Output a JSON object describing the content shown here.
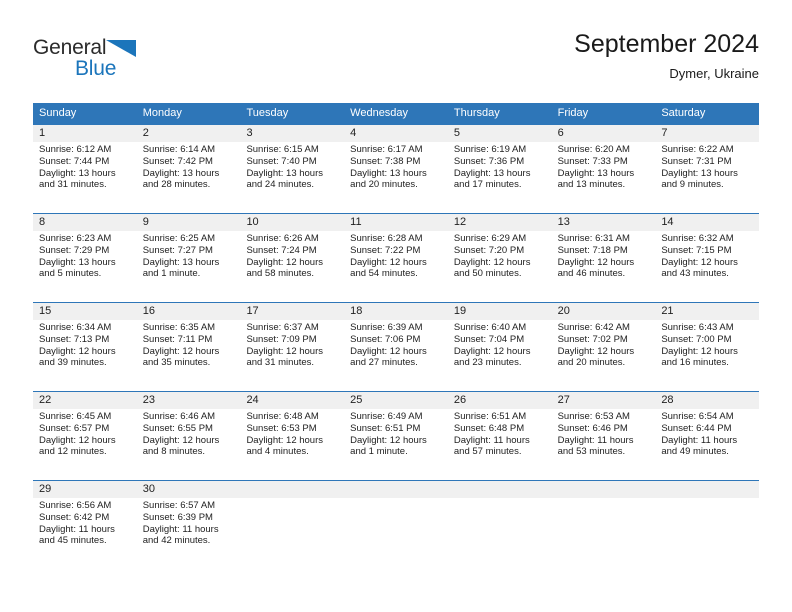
{
  "brand": {
    "name_part1": "General",
    "name_part2": "Blue",
    "triangle_color": "#1b75bb",
    "text_color_part1": "#2b2b2b"
  },
  "header": {
    "title": "September 2024",
    "subtitle": "Dymer, Ukraine"
  },
  "colors": {
    "header_bar": "#2e76b8",
    "day_number_row": "#f0f0f0",
    "text": "#222222",
    "accent_blue": "#1b75bb"
  },
  "weekdays": [
    "Sunday",
    "Monday",
    "Tuesday",
    "Wednesday",
    "Thursday",
    "Friday",
    "Saturday"
  ],
  "weeks": [
    {
      "days": [
        {
          "num": "1",
          "sunrise": "Sunrise: 6:12 AM",
          "sunset": "Sunset: 7:44 PM",
          "daylight1": "Daylight: 13 hours",
          "daylight2": "and 31 minutes."
        },
        {
          "num": "2",
          "sunrise": "Sunrise: 6:14 AM",
          "sunset": "Sunset: 7:42 PM",
          "daylight1": "Daylight: 13 hours",
          "daylight2": "and 28 minutes."
        },
        {
          "num": "3",
          "sunrise": "Sunrise: 6:15 AM",
          "sunset": "Sunset: 7:40 PM",
          "daylight1": "Daylight: 13 hours",
          "daylight2": "and 24 minutes."
        },
        {
          "num": "4",
          "sunrise": "Sunrise: 6:17 AM",
          "sunset": "Sunset: 7:38 PM",
          "daylight1": "Daylight: 13 hours",
          "daylight2": "and 20 minutes."
        },
        {
          "num": "5",
          "sunrise": "Sunrise: 6:19 AM",
          "sunset": "Sunset: 7:36 PM",
          "daylight1": "Daylight: 13 hours",
          "daylight2": "and 17 minutes."
        },
        {
          "num": "6",
          "sunrise": "Sunrise: 6:20 AM",
          "sunset": "Sunset: 7:33 PM",
          "daylight1": "Daylight: 13 hours",
          "daylight2": "and 13 minutes."
        },
        {
          "num": "7",
          "sunrise": "Sunrise: 6:22 AM",
          "sunset": "Sunset: 7:31 PM",
          "daylight1": "Daylight: 13 hours",
          "daylight2": "and 9 minutes."
        }
      ]
    },
    {
      "days": [
        {
          "num": "8",
          "sunrise": "Sunrise: 6:23 AM",
          "sunset": "Sunset: 7:29 PM",
          "daylight1": "Daylight: 13 hours",
          "daylight2": "and 5 minutes."
        },
        {
          "num": "9",
          "sunrise": "Sunrise: 6:25 AM",
          "sunset": "Sunset: 7:27 PM",
          "daylight1": "Daylight: 13 hours",
          "daylight2": "and 1 minute."
        },
        {
          "num": "10",
          "sunrise": "Sunrise: 6:26 AM",
          "sunset": "Sunset: 7:24 PM",
          "daylight1": "Daylight: 12 hours",
          "daylight2": "and 58 minutes."
        },
        {
          "num": "11",
          "sunrise": "Sunrise: 6:28 AM",
          "sunset": "Sunset: 7:22 PM",
          "daylight1": "Daylight: 12 hours",
          "daylight2": "and 54 minutes."
        },
        {
          "num": "12",
          "sunrise": "Sunrise: 6:29 AM",
          "sunset": "Sunset: 7:20 PM",
          "daylight1": "Daylight: 12 hours",
          "daylight2": "and 50 minutes."
        },
        {
          "num": "13",
          "sunrise": "Sunrise: 6:31 AM",
          "sunset": "Sunset: 7:18 PM",
          "daylight1": "Daylight: 12 hours",
          "daylight2": "and 46 minutes."
        },
        {
          "num": "14",
          "sunrise": "Sunrise: 6:32 AM",
          "sunset": "Sunset: 7:15 PM",
          "daylight1": "Daylight: 12 hours",
          "daylight2": "and 43 minutes."
        }
      ]
    },
    {
      "days": [
        {
          "num": "15",
          "sunrise": "Sunrise: 6:34 AM",
          "sunset": "Sunset: 7:13 PM",
          "daylight1": "Daylight: 12 hours",
          "daylight2": "and 39 minutes."
        },
        {
          "num": "16",
          "sunrise": "Sunrise: 6:35 AM",
          "sunset": "Sunset: 7:11 PM",
          "daylight1": "Daylight: 12 hours",
          "daylight2": "and 35 minutes."
        },
        {
          "num": "17",
          "sunrise": "Sunrise: 6:37 AM",
          "sunset": "Sunset: 7:09 PM",
          "daylight1": "Daylight: 12 hours",
          "daylight2": "and 31 minutes."
        },
        {
          "num": "18",
          "sunrise": "Sunrise: 6:39 AM",
          "sunset": "Sunset: 7:06 PM",
          "daylight1": "Daylight: 12 hours",
          "daylight2": "and 27 minutes."
        },
        {
          "num": "19",
          "sunrise": "Sunrise: 6:40 AM",
          "sunset": "Sunset: 7:04 PM",
          "daylight1": "Daylight: 12 hours",
          "daylight2": "and 23 minutes."
        },
        {
          "num": "20",
          "sunrise": "Sunrise: 6:42 AM",
          "sunset": "Sunset: 7:02 PM",
          "daylight1": "Daylight: 12 hours",
          "daylight2": "and 20 minutes."
        },
        {
          "num": "21",
          "sunrise": "Sunrise: 6:43 AM",
          "sunset": "Sunset: 7:00 PM",
          "daylight1": "Daylight: 12 hours",
          "daylight2": "and 16 minutes."
        }
      ]
    },
    {
      "days": [
        {
          "num": "22",
          "sunrise": "Sunrise: 6:45 AM",
          "sunset": "Sunset: 6:57 PM",
          "daylight1": "Daylight: 12 hours",
          "daylight2": "and 12 minutes."
        },
        {
          "num": "23",
          "sunrise": "Sunrise: 6:46 AM",
          "sunset": "Sunset: 6:55 PM",
          "daylight1": "Daylight: 12 hours",
          "daylight2": "and 8 minutes."
        },
        {
          "num": "24",
          "sunrise": "Sunrise: 6:48 AM",
          "sunset": "Sunset: 6:53 PM",
          "daylight1": "Daylight: 12 hours",
          "daylight2": "and 4 minutes."
        },
        {
          "num": "25",
          "sunrise": "Sunrise: 6:49 AM",
          "sunset": "Sunset: 6:51 PM",
          "daylight1": "Daylight: 12 hours",
          "daylight2": "and 1 minute."
        },
        {
          "num": "26",
          "sunrise": "Sunrise: 6:51 AM",
          "sunset": "Sunset: 6:48 PM",
          "daylight1": "Daylight: 11 hours",
          "daylight2": "and 57 minutes."
        },
        {
          "num": "27",
          "sunrise": "Sunrise: 6:53 AM",
          "sunset": "Sunset: 6:46 PM",
          "daylight1": "Daylight: 11 hours",
          "daylight2": "and 53 minutes."
        },
        {
          "num": "28",
          "sunrise": "Sunrise: 6:54 AM",
          "sunset": "Sunset: 6:44 PM",
          "daylight1": "Daylight: 11 hours",
          "daylight2": "and 49 minutes."
        }
      ]
    },
    {
      "days": [
        {
          "num": "29",
          "sunrise": "Sunrise: 6:56 AM",
          "sunset": "Sunset: 6:42 PM",
          "daylight1": "Daylight: 11 hours",
          "daylight2": "and 45 minutes."
        },
        {
          "num": "30",
          "sunrise": "Sunrise: 6:57 AM",
          "sunset": "Sunset: 6:39 PM",
          "daylight1": "Daylight: 11 hours",
          "daylight2": "and 42 minutes."
        },
        {
          "num": "",
          "sunrise": "",
          "sunset": "",
          "daylight1": "",
          "daylight2": ""
        },
        {
          "num": "",
          "sunrise": "",
          "sunset": "",
          "daylight1": "",
          "daylight2": ""
        },
        {
          "num": "",
          "sunrise": "",
          "sunset": "",
          "daylight1": "",
          "daylight2": ""
        },
        {
          "num": "",
          "sunrise": "",
          "sunset": "",
          "daylight1": "",
          "daylight2": ""
        },
        {
          "num": "",
          "sunrise": "",
          "sunset": "",
          "daylight1": "",
          "daylight2": ""
        }
      ]
    }
  ]
}
